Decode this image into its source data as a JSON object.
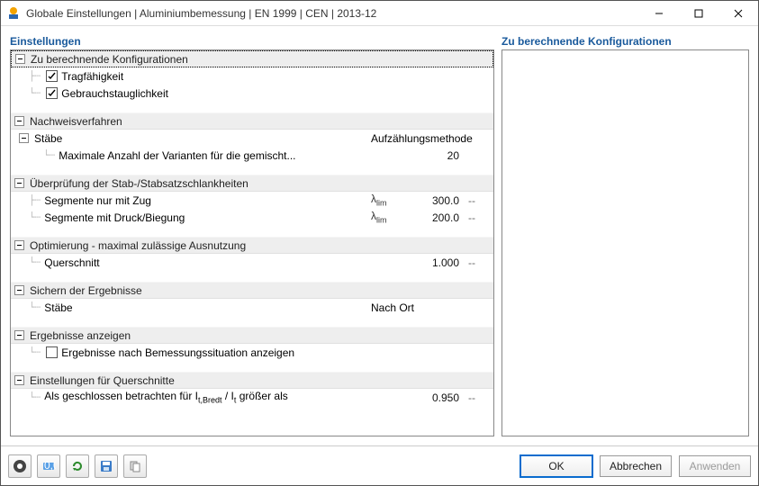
{
  "title": "Globale Einstellungen | Aluminiumbemessung | EN 1999 | CEN | 2013-12",
  "left_label": "Einstellungen",
  "right_label": "Zu berechnende Konfigurationen",
  "groups": {
    "g1": {
      "header": "Zu berechnende Konfigurationen",
      "items": {
        "r1": {
          "label": "Tragfähigkeit",
          "checked": true
        },
        "r2": {
          "label": "Gebrauchstauglichkeit",
          "checked": true
        }
      }
    },
    "g2": {
      "header": "Nachweisverfahren",
      "sub": {
        "label": "Stäbe",
        "col2": "Aufzählungsmethode"
      },
      "items": {
        "r1": {
          "label": "Maximale Anzahl der Varianten für die gemischt...",
          "val": "20"
        }
      }
    },
    "g3": {
      "header": "Überprüfung der Stab-/Stabsatzschlankheiten",
      "items": {
        "r1": {
          "label": "Segmente nur mit Zug",
          "sym": "λlim",
          "val": "300.0",
          "unit": "--"
        },
        "r2": {
          "label": "Segmente mit Druck/Biegung",
          "sym": "λlim",
          "val": "200.0",
          "unit": "--"
        }
      }
    },
    "g4": {
      "header": "Optimierung - maximal zulässige Ausnutzung",
      "items": {
        "r1": {
          "label": "Querschnitt",
          "val": "1.000",
          "unit": "--"
        }
      }
    },
    "g5": {
      "header": "Sichern der Ergebnisse",
      "items": {
        "r1": {
          "label": "Stäbe",
          "col2": "Nach Ort"
        }
      }
    },
    "g6": {
      "header": "Ergebnisse anzeigen",
      "items": {
        "r1": {
          "label": "Ergebnisse nach Bemessungssituation anzeigen",
          "checked": false
        }
      }
    },
    "g7": {
      "header": "Einstellungen für Querschnitte",
      "items": {
        "r1": {
          "label_pre": "Als geschlossen betrachten für I",
          "label_sub1": "t,Bredt",
          "label_mid": " / I",
          "label_sub2": "t",
          "label_post": " größer als",
          "val": "0.950",
          "unit": "--"
        }
      }
    }
  },
  "buttons": {
    "ok": "OK",
    "cancel": "Abbrechen",
    "apply": "Anwenden"
  }
}
